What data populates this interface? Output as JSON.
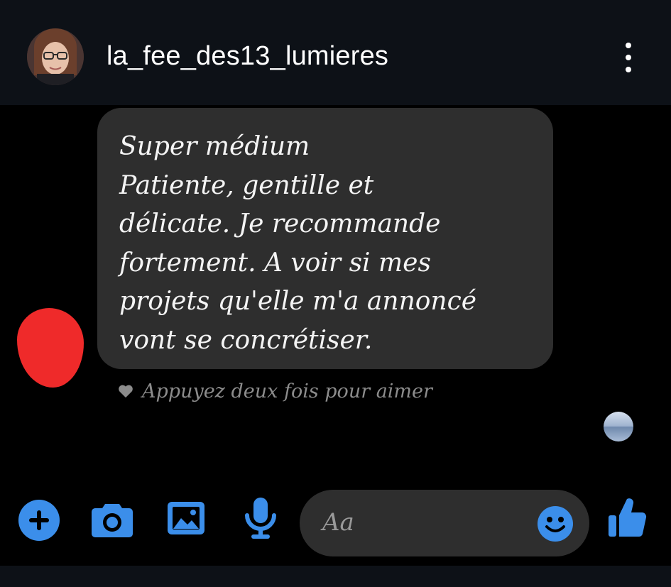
{
  "header": {
    "username": "la_fee_des13_lumieres",
    "avatar_icon": "profile-photo",
    "menu_icon": "more-vertical-icon"
  },
  "message": {
    "lines": [
      "Super médium",
      "Patiente, gentille et",
      "délicate. Je recommande",
      "fortement. A voir si mes",
      "projets qu'elle m'a annoncé",
      "vont se concrétiser."
    ],
    "hint": "Appuyez deux fois pour aimer",
    "hint_icon": "heart-icon"
  },
  "composer": {
    "placeholder": "Aa",
    "tools": [
      "plus-circle-icon",
      "camera-icon",
      "image-icon",
      "microphone-icon"
    ],
    "emoji_icon": "smile-emoji-icon",
    "like_icon": "thumbs-up-icon"
  },
  "colors": {
    "accent": "#3b8eea",
    "bubble": "#2e2e2e",
    "header_bg": "#0d1117",
    "background": "#000000",
    "redaction": "#ef2a2a"
  }
}
